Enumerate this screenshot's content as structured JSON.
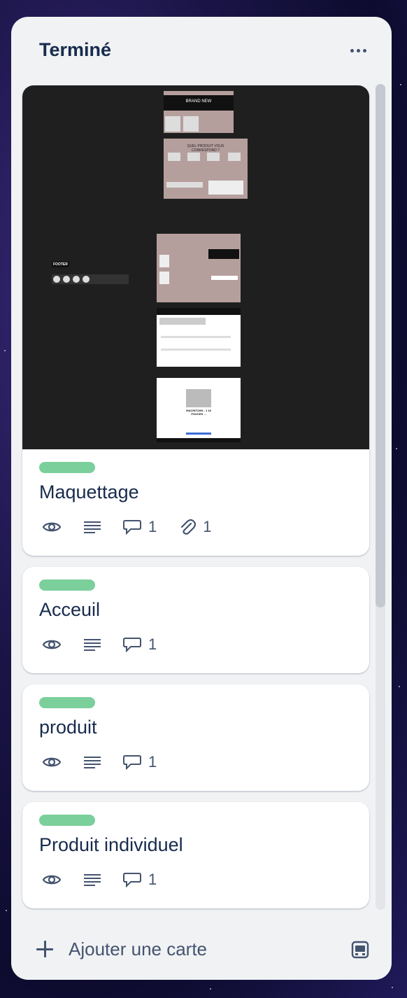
{
  "list": {
    "title": "Terminé",
    "menu_icon": "more-horizontal-icon",
    "add_card_label": "Ajouter une carte",
    "add_icon": "plus-icon",
    "template_icon": "card-template-icon"
  },
  "colors": {
    "label_green": "#7bcf9b",
    "list_bg": "#f1f2f4",
    "text": "#172b4d",
    "icon": "#44546f"
  },
  "cards": [
    {
      "title": "Maquettage",
      "has_cover": true,
      "label_color": "#7bcf9b",
      "badges": {
        "watch": true,
        "description": true,
        "comments": "1",
        "attachments": "1"
      },
      "cover": {
        "texts": {
          "brand": "BRAND NEW",
          "question": "QUEL PRODUIT VOUS CORRESPOND ?",
          "footer": "FOOTER",
          "product": "MACINTOSH - 1 18 POUCES ..."
        }
      }
    },
    {
      "title": "Acceuil",
      "has_cover": false,
      "label_color": "#7bcf9b",
      "badges": {
        "watch": true,
        "description": true,
        "comments": "1"
      }
    },
    {
      "title": "produit",
      "has_cover": false,
      "label_color": "#7bcf9b",
      "badges": {
        "watch": true,
        "description": true,
        "comments": "1"
      }
    },
    {
      "title": "Produit individuel",
      "has_cover": false,
      "label_color": "#7bcf9b",
      "badges": {
        "watch": true,
        "description": true,
        "comments": "1"
      }
    }
  ]
}
